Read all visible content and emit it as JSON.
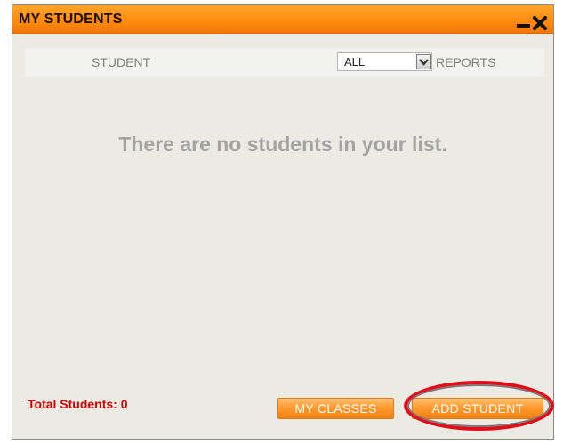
{
  "window": {
    "title": "MY STUDENTS",
    "minimize_icon": "minimize-icon",
    "close_icon": "close-icon"
  },
  "header": {
    "student_label": "STUDENT",
    "filter_value": "ALL",
    "reports_label": "REPORTS"
  },
  "list": {
    "empty_message": "There are no students in your list."
  },
  "footer": {
    "total_label": "Total Students:",
    "total_count": "0",
    "my_classes_label": "MY CLASSES",
    "add_student_label": "ADD STUDENT"
  },
  "colors": {
    "titlebar": "#ff8c10",
    "panel_bg": "#ebebe4",
    "button_orange": "#ff9a30",
    "total_text": "#d50000",
    "highlight_ring": "#e20f1b"
  }
}
